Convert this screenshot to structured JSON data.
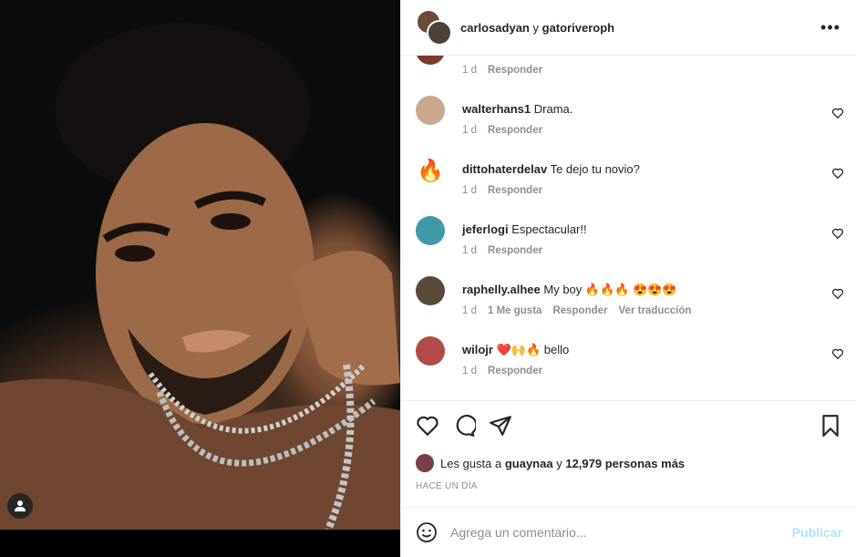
{
  "header": {
    "user1": "carlosadyan",
    "connector": "y",
    "user2": "gatoriveroph",
    "more_icon": "more-horizontal-icon"
  },
  "partial_comment": {
    "time": "1 d",
    "reply": "Responder"
  },
  "comments": [
    {
      "user": "walterhans1",
      "text": "Drama.",
      "time": "1 d",
      "reply": "Responder",
      "avatar_color": "#c9a88d"
    },
    {
      "user": "dittohaterdelav",
      "text": "Te dejo tu novio?",
      "time": "1 d",
      "reply": "Responder",
      "avatar_color": "#ffffff"
    },
    {
      "user": "jeferlogi",
      "text": "Espectacular!!",
      "time": "1 d",
      "reply": "Responder",
      "avatar_color": "#3f9aa7"
    },
    {
      "user": "raphelly.alhee",
      "text": "My boy 🔥🔥🔥 😍😍😍",
      "time": "1 d",
      "likes": "1 Me gusta",
      "reply": "Responder",
      "translate": "Ver traducción",
      "avatar_color": "#5a4a3a"
    },
    {
      "user": "wilojr",
      "text": "❤️🙌🔥 bello",
      "time": "1 d",
      "reply": "Responder",
      "avatar_color": "#b34a4a"
    }
  ],
  "likes": {
    "prefix": "Les gusta a",
    "user": "guaynaa",
    "middle": "y",
    "count": "12,979 personas más"
  },
  "timestamp": "HACE UN DÍA",
  "add_comment": {
    "placeholder": "Agrega un comentario...",
    "publish": "Publicar"
  },
  "colors": {
    "accent_disabled": "#b2dffc",
    "muted": "#8e8e8e",
    "text": "#262626"
  }
}
